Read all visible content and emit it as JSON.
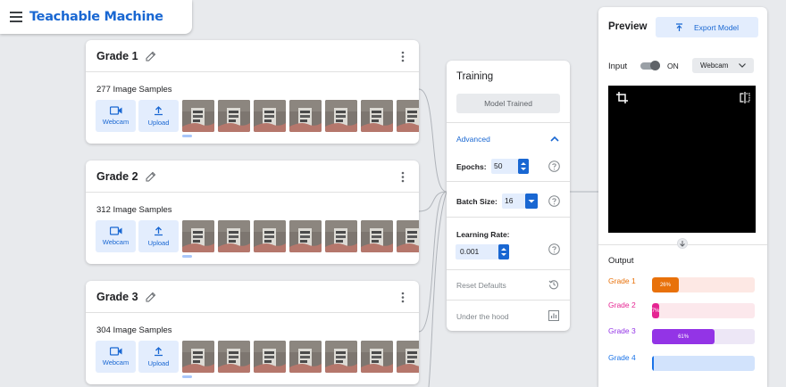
{
  "app": {
    "title": "Teachable Machine"
  },
  "classes": [
    {
      "name": "Grade 1",
      "samples": "277 Image Samples",
      "webcam": "Webcam",
      "upload": "Upload"
    },
    {
      "name": "Grade 2",
      "samples": "312 Image Samples",
      "webcam": "Webcam",
      "upload": "Upload"
    },
    {
      "name": "Grade 3",
      "samples": "304 Image Samples",
      "webcam": "Webcam",
      "upload": "Upload"
    }
  ],
  "training": {
    "title": "Training",
    "button": "Model Trained",
    "advanced": "Advanced",
    "epochs_label": "Epochs:",
    "epochs_value": "50",
    "batch_label": "Batch Size:",
    "batch_value": "16",
    "lr_label": "Learning Rate:",
    "lr_value": "0.001",
    "reset": "Reset Defaults",
    "under_hood": "Under the hood"
  },
  "preview": {
    "title": "Preview",
    "export": "Export Model",
    "input_label": "Input",
    "toggle_state": "ON",
    "source": "Webcam",
    "output_title": "Output",
    "outputs": [
      {
        "label": "Grade 1",
        "percent": 26,
        "text": "26%",
        "color": "#e8710a",
        "track": "#fde8e4"
      },
      {
        "label": "Grade 2",
        "percent": 7,
        "text": "7%",
        "color": "#e52592",
        "track": "#fce8ec"
      },
      {
        "label": "Grade 3",
        "percent": 61,
        "text": "61%",
        "color": "#9334e6",
        "track": "#ede7f6"
      },
      {
        "label": "Grade 4",
        "percent": 2,
        "text": "",
        "color": "#1a73e8",
        "track": "#d2e3fc"
      }
    ]
  },
  "colors": {
    "accent": "#1967d2",
    "light_accent": "#e3edfd"
  }
}
